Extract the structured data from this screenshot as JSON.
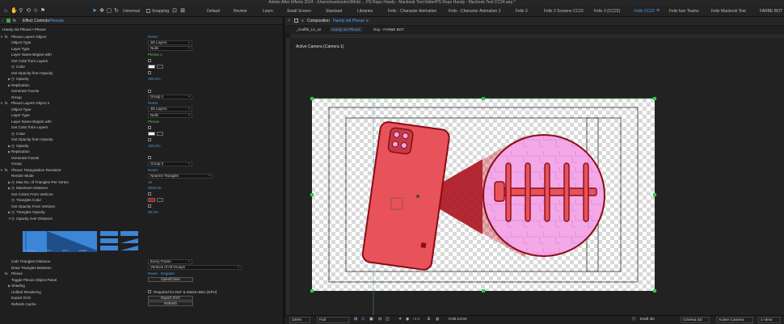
{
  "app": {
    "title": "Adobe After Effects 2024 - /Users/macbookm3Mobi ... PS Repo Handy - Macbook Test folder/PS Repo Handy - Macbook Test CC24.aep *"
  },
  "toolbar": {
    "universal_label": "Universal",
    "snapping_label": "Snapping",
    "workspaces": [
      "Default",
      "Review",
      "Learn",
      "Small Screen",
      "Standard",
      "Libraries",
      "Felix - Character Animation",
      "Felix - Character Animation 2",
      "Felix 2",
      "Felix 2 Screens CC23",
      "Felix 3 (CC22)",
      "Felix CC23",
      "Felix fuer Teams",
      "Felix Macbook Test"
    ],
    "active_workspace": "Felix CC23",
    "last_workspace": "FARBE BOT"
  },
  "effect_controls": {
    "tab_label": "Effect Controls",
    "tab_layer": "Plexus",
    "breadcrumb": "Handy mit Plexus • Plexus",
    "rows": [
      {
        "indent": 1,
        "twirl": "open",
        "fx": true,
        "label": "Plexus Layers Object",
        "type": "link",
        "value": "Reset"
      },
      {
        "indent": 2,
        "label": "Object Type",
        "type": "dropdown",
        "value": "3D Layers"
      },
      {
        "indent": 2,
        "label": "Layer Type",
        "type": "dropdown",
        "value": "Nulls"
      },
      {
        "indent": 2,
        "label": "Layer Name Begins with",
        "type": "green",
        "value": "Plexus 1"
      },
      {
        "indent": 2,
        "label": "Get Color from Layers",
        "type": "checkbox"
      },
      {
        "indent": 2,
        "stopwatch": true,
        "label": "Color",
        "type": "swatch",
        "color": "#ffffff"
      },
      {
        "indent": 2,
        "label": "Get Opacity from Opacity",
        "type": "checkbox"
      },
      {
        "indent": 2,
        "twirl": "closed",
        "stopwatch": true,
        "label": "Opacity",
        "type": "blue",
        "value": "100,0%"
      },
      {
        "indent": 2,
        "twirl": "closed",
        "label": "Replication",
        "type": "none"
      },
      {
        "indent": 2,
        "label": "Generate Facets",
        "type": "checkbox"
      },
      {
        "indent": 2,
        "label": "Group",
        "type": "dropdown",
        "value": "Group 1"
      },
      {
        "indent": 1,
        "twirl": "open",
        "fx": true,
        "label": "Plexus Layers Object 2",
        "type": "link",
        "value": "Reset"
      },
      {
        "indent": 2,
        "label": "Object Type",
        "type": "dropdown",
        "value": "3D Layers"
      },
      {
        "indent": 2,
        "label": "Layer Type",
        "type": "dropdown",
        "value": "Nulls"
      },
      {
        "indent": 2,
        "label": "Layer Name Begins with",
        "type": "green",
        "value": "Plexus"
      },
      {
        "indent": 2,
        "label": "Get Color from Layers",
        "type": "checkbox"
      },
      {
        "indent": 2,
        "stopwatch": true,
        "label": "Color",
        "type": "swatch",
        "color": "#ffffff"
      },
      {
        "indent": 2,
        "label": "Get Opacity from Opacity",
        "type": "checkbox"
      },
      {
        "indent": 2,
        "twirl": "closed",
        "stopwatch": true,
        "label": "Opacity",
        "type": "blue",
        "value": "100,0%"
      },
      {
        "indent": 2,
        "twirl": "closed",
        "label": "Replication",
        "type": "none"
      },
      {
        "indent": 2,
        "label": "Generate Facets",
        "type": "checkbox"
      },
      {
        "indent": 2,
        "label": "Group",
        "type": "dropdown",
        "value": "Group 2"
      },
      {
        "indent": 1,
        "twirl": "open",
        "fx": true,
        "label": "Plexus Triangulation Renderer",
        "type": "link",
        "value": "Reset"
      },
      {
        "indent": 2,
        "label": "Render Mode",
        "type": "dropdown-wide",
        "value": "Nearest Triangles"
      },
      {
        "indent": 2,
        "twirl": "closed",
        "stopwatch": true,
        "label": "Max No. of Triangles Per Vertex",
        "type": "blue",
        "value": "10"
      },
      {
        "indent": 2,
        "twirl": "closed",
        "stopwatch": true,
        "label": "Maximum Distance",
        "type": "blue",
        "value": "2000,00"
      },
      {
        "indent": 2,
        "label": "Get Colors From Vertices",
        "type": "checkbox"
      },
      {
        "indent": 2,
        "stopwatch": true,
        "label": "Triangles Color",
        "type": "swatch",
        "color": "#c0121e"
      },
      {
        "indent": 2,
        "label": "Get Opacity From Vertices",
        "type": "checkbox"
      },
      {
        "indent": 2,
        "twirl": "closed",
        "stopwatch": true,
        "label": "Triangles Opacity",
        "type": "blue",
        "value": "50,0%"
      },
      {
        "indent": 2,
        "twirl": "open",
        "stopwatch": true,
        "label": "Opacity over Distance",
        "type": "none"
      }
    ],
    "graph_labels": [
      "ELT-FACE",
      "FULL",
      "HALF",
      "QUART"
    ],
    "rows2": [
      {
        "label": "Calc Triangles Distance",
        "type": "dropdown",
        "value": "Every Frame"
      },
      {
        "label": "Draw Triangles Between",
        "type": "dropdown-wide",
        "value": "Vertices of All Groups"
      },
      {
        "label": "Plexus",
        "type": "reset-register",
        "value": "Reset",
        "value2": "Register",
        "fx": true
      },
      {
        "label": "Toggle Plexus Object Panel",
        "type": "button",
        "value": "Open/Close"
      },
      {
        "label": "Shading",
        "type": "none",
        "twirl": "closed"
      },
      {
        "label": "Unified Rendering",
        "type": "checkbox-text",
        "value": "Required for DoF & Motion Blur (GPU)"
      },
      {
        "label": "Export SVG",
        "type": "button",
        "value": "Export SVG"
      },
      {
        "label": "Refresh Cache",
        "type": "button",
        "value": "Refresh"
      }
    ]
  },
  "composition": {
    "tab_label": "Composition",
    "tab_comp": "Handy mit Plexus",
    "subtabs": [
      "_Graffiti_14_v2",
      "Handy mit Plexus",
      "Ray - FARBE BOT"
    ],
    "active_subtab": "Handy mit Plexus",
    "camera_label": "Active Camera (Camera 1)",
    "colors": {
      "accent": "#c0121e",
      "pink": "#f3a8e8",
      "phone": "#e8525a"
    }
  },
  "viewer_bar": {
    "zoom": "100%",
    "resolution": "Full",
    "exposure": "+0,0",
    "timecode": "0:00:13:04",
    "renderer": "Draft 3D",
    "engine": "Cinema 4D",
    "camera": "Active Camera",
    "views": "1 View"
  }
}
